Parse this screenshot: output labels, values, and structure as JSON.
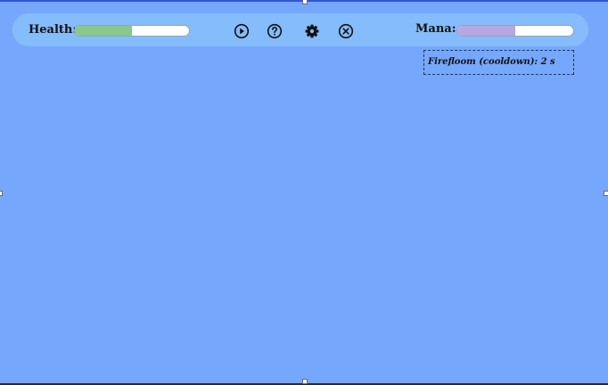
{
  "hud": {
    "health_label": "Health:",
    "mana_label": "Mana:",
    "health_fraction": 0.5,
    "mana_fraction": 0.5,
    "health_color": "#86c98a",
    "mana_color": "#b7a6df"
  },
  "controls": {
    "play_icon": "play-circle-icon",
    "help_icon": "question-circle-icon",
    "settings_icon": "gear-icon",
    "close_icon": "close-circle-icon"
  },
  "status": {
    "cooldown_text": "Firefloom (cooldown): 2 s"
  },
  "colors": {
    "background": "#75a8fd",
    "hud_bar": "#85bcfb"
  }
}
